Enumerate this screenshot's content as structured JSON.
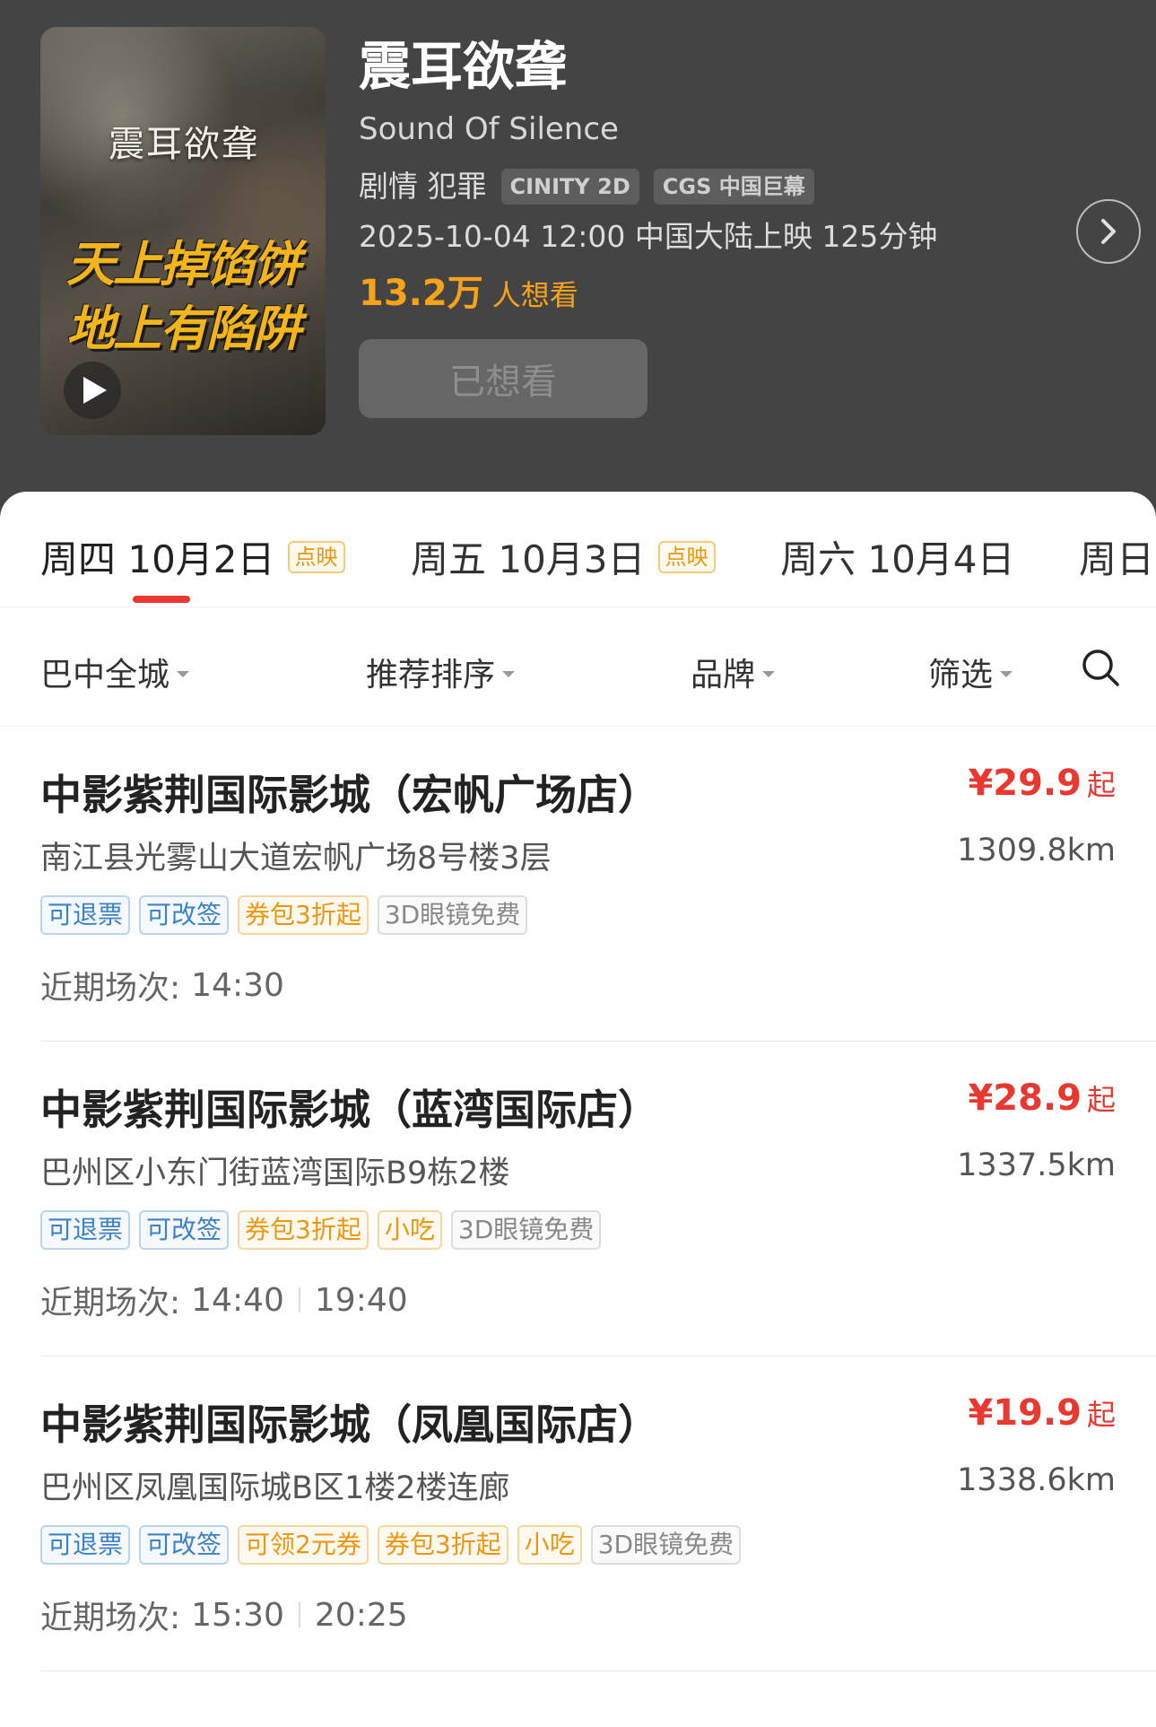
{
  "movie": {
    "title_cn": "震耳欲聋",
    "title_en": "Sound Of Silence",
    "genres": "剧情 犯罪",
    "formats": [
      "CINITY 2D",
      "CGS 中国巨幕"
    ],
    "release": "2025-10-04 12:00 中国大陆上映 125分钟",
    "want_count": "13.2万",
    "want_label": "人想看",
    "wanted_button": "已想看",
    "poster": {
      "title": "震耳欲聋",
      "slogan_line1": "天上掉馅饼",
      "slogan_line2": "地上有陷阱",
      "play_icon": "play-icon"
    }
  },
  "date_tabs": [
    {
      "label": "周四 10月2日",
      "badge": "点映",
      "active": true
    },
    {
      "label": "周五 10月3日",
      "badge": "点映",
      "active": false
    },
    {
      "label": "周六 10月4日",
      "badge": "",
      "active": false
    },
    {
      "label": "周日",
      "badge": "",
      "active": false
    }
  ],
  "filters": {
    "area": "巴中全城",
    "sort": "推荐排序",
    "brand": "品牌",
    "filter": "筛选",
    "search_icon": "search-icon"
  },
  "cinemas": [
    {
      "name": "中影紫荆国际影城（宏帆广场店）",
      "price": "¥29.9",
      "price_suffix": "起",
      "address": "南江县光雾山大道宏帆广场8号楼3层",
      "distance": "1309.8km",
      "tags": [
        {
          "text": "可退票",
          "style": "blue"
        },
        {
          "text": "可改签",
          "style": "blue"
        },
        {
          "text": "券包3折起",
          "style": "orange"
        },
        {
          "text": "3D眼镜免费",
          "style": "gray"
        }
      ],
      "sessions_label": "近期场次:",
      "sessions": [
        "14:30"
      ]
    },
    {
      "name": "中影紫荆国际影城（蓝湾国际店）",
      "price": "¥28.9",
      "price_suffix": "起",
      "address": "巴州区小东门街蓝湾国际B9栋2楼",
      "distance": "1337.5km",
      "tags": [
        {
          "text": "可退票",
          "style": "blue"
        },
        {
          "text": "可改签",
          "style": "blue"
        },
        {
          "text": "券包3折起",
          "style": "orange"
        },
        {
          "text": "小吃",
          "style": "orange"
        },
        {
          "text": "3D眼镜免费",
          "style": "gray"
        }
      ],
      "sessions_label": "近期场次:",
      "sessions": [
        "14:40",
        "19:40"
      ]
    },
    {
      "name": "中影紫荆国际影城（凤凰国际店）",
      "price": "¥19.9",
      "price_suffix": "起",
      "address": "巴州区凤凰国际城B区1楼2楼连廊",
      "distance": "1338.6km",
      "tags": [
        {
          "text": "可退票",
          "style": "blue"
        },
        {
          "text": "可改签",
          "style": "blue"
        },
        {
          "text": "可领2元券",
          "style": "orange"
        },
        {
          "text": "券包3折起",
          "style": "orange"
        },
        {
          "text": "小吃",
          "style": "orange"
        },
        {
          "text": "3D眼镜免费",
          "style": "gray"
        }
      ],
      "sessions_label": "近期场次:",
      "sessions": [
        "15:30",
        "20:25"
      ]
    }
  ],
  "colors": {
    "header_bg": "#444444",
    "accent_red": "#e9382f",
    "want_orange": "#f6a319"
  }
}
